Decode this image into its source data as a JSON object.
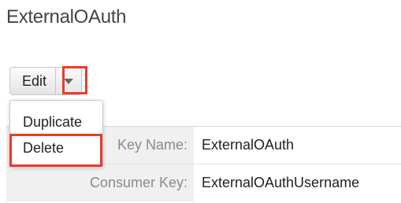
{
  "page": {
    "title": "ExternalOAuth"
  },
  "actions": {
    "edit_label": "Edit",
    "menu_items": [
      "Duplicate",
      "Delete"
    ]
  },
  "details": {
    "rows": [
      {
        "label": "Key Name:",
        "value": "ExternalOAuth"
      },
      {
        "label": "Consumer Key:",
        "value": "ExternalOAuthUsername"
      }
    ]
  },
  "icons": {
    "dropdown": "chevron-down-icon"
  },
  "colors": {
    "highlight": "#ee3a29",
    "label_bg": "#f0f0f0"
  }
}
